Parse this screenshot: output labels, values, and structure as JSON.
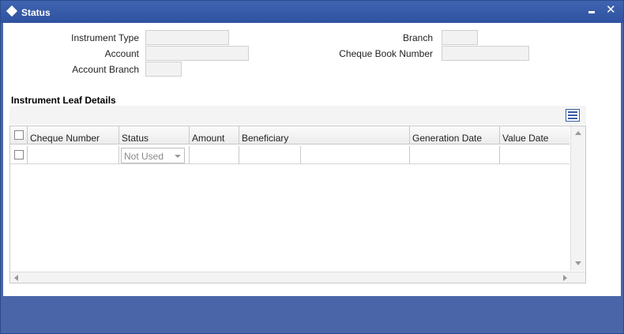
{
  "window": {
    "title": "Status"
  },
  "form": {
    "instrument_type": {
      "label": "Instrument Type",
      "value": ""
    },
    "account": {
      "label": "Account",
      "value": ""
    },
    "account_branch": {
      "label": "Account Branch",
      "value": ""
    },
    "branch": {
      "label": "Branch",
      "value": ""
    },
    "cheque_book_number": {
      "label": "Cheque Book Number",
      "value": ""
    }
  },
  "section": {
    "title": "Instrument Leaf Details"
  },
  "table": {
    "columns": [
      "Cheque Number",
      "Status",
      "Amount",
      "Beneficiary",
      "Generation Date",
      "Value Date"
    ],
    "rows": [
      {
        "cheque_number": "",
        "status": "Not Used",
        "amount": "",
        "beneficiary": "",
        "generation_date": "",
        "value_date": ""
      }
    ]
  },
  "icons": {
    "title": "diamond-icon",
    "minimize": "minimize-icon",
    "close": "close-icon",
    "grid": "list-view-icon"
  },
  "colors": {
    "titlebar": "#2f52a0",
    "background": "#4a66a8",
    "field": "#f2f2f2"
  }
}
